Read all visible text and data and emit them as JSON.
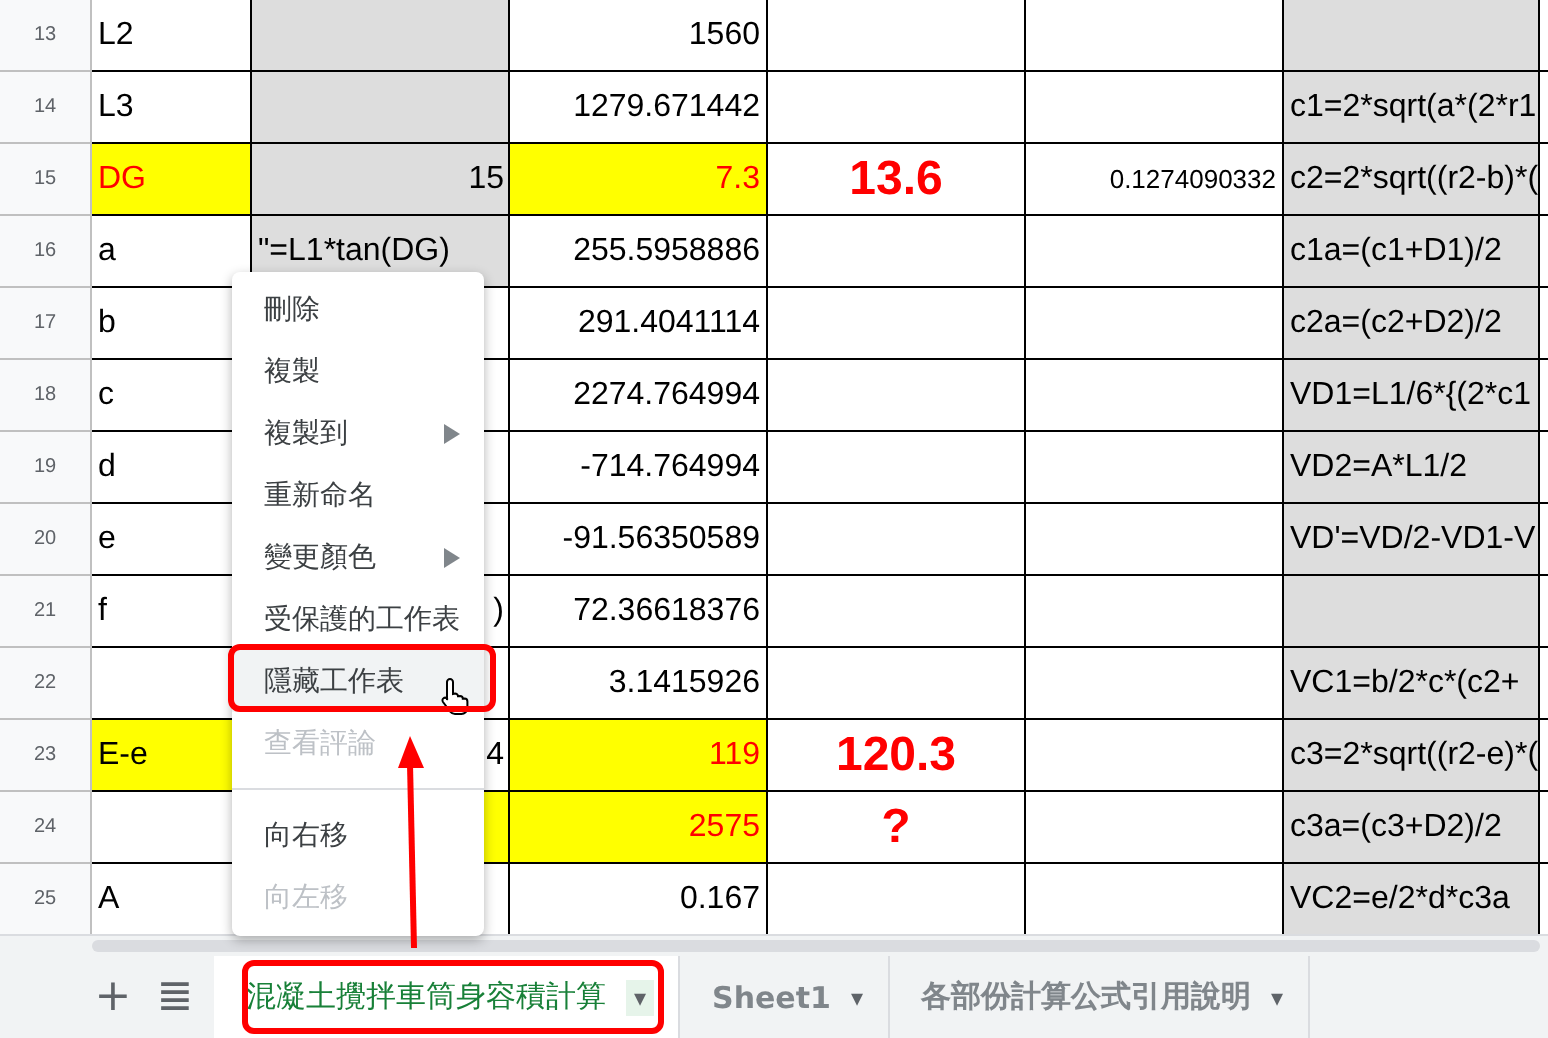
{
  "rows": [
    {
      "number": "13",
      "cells": [
        {
          "text": "L2",
          "kind": "label",
          "shaded": false,
          "highlighted": false
        },
        {
          "kind": "label",
          "shaded": true,
          "highlighted": false
        },
        {
          "text": "1560",
          "kind": "number",
          "shaded": false,
          "highlighted": false
        },
        {
          "kind": "label",
          "shaded": false,
          "highlighted": false
        },
        {
          "kind": "label",
          "shaded": false,
          "highlighted": false
        },
        {
          "kind": "label",
          "shaded": true,
          "highlighted": false
        }
      ]
    },
    {
      "number": "14",
      "cells": [
        {
          "text": "L3",
          "kind": "label",
          "shaded": false,
          "highlighted": false
        },
        {
          "kind": "label",
          "shaded": true,
          "highlighted": false
        },
        {
          "text": "1279.671442",
          "kind": "number",
          "shaded": false,
          "highlighted": false
        },
        {
          "kind": "label",
          "shaded": false,
          "highlighted": false
        },
        {
          "kind": "label",
          "shaded": false,
          "highlighted": false
        },
        {
          "text": "c1=2*sqrt(a*(2*r1",
          "kind": "label",
          "shaded": true,
          "highlighted": false
        }
      ]
    },
    {
      "number": "15",
      "cells": [
        {
          "text": "DG",
          "kind": "label",
          "shaded": false,
          "highlighted": true,
          "color": "#ff0000"
        },
        {
          "text": "15",
          "kind": "number",
          "shaded": true,
          "highlighted": false
        },
        {
          "text": "7.3",
          "kind": "number",
          "shaded": false,
          "highlighted": true,
          "color": "#ff0000"
        },
        {
          "text": "13.6",
          "kind": "big",
          "shaded": false,
          "highlighted": false,
          "color": "#ff0000"
        },
        {
          "text": "0.1274090332",
          "kind": "small",
          "shaded": false,
          "highlighted": false
        },
        {
          "text": "c2=2*sqrt((r2-b)*(",
          "kind": "label",
          "shaded": true,
          "highlighted": false
        }
      ]
    },
    {
      "number": "16",
      "cells": [
        {
          "text": "a",
          "kind": "label",
          "shaded": false,
          "highlighted": false
        },
        {
          "text": "\"=L1*tan(DG)",
          "kind": "label",
          "shaded": true,
          "highlighted": false
        },
        {
          "text": "255.5958886",
          "kind": "number",
          "shaded": false,
          "highlighted": false
        },
        {
          "kind": "label",
          "shaded": false,
          "highlighted": false
        },
        {
          "kind": "label",
          "shaded": false,
          "highlighted": false
        },
        {
          "text": "c1a=(c1+D1)/2",
          "kind": "label",
          "shaded": true,
          "highlighted": false
        }
      ]
    },
    {
      "number": "17",
      "cells": [
        {
          "text": "b",
          "kind": "label",
          "shaded": false,
          "highlighted": false
        },
        {
          "kind": "label",
          "shaded": false,
          "highlighted": false
        },
        {
          "text": "291.4041114",
          "kind": "number",
          "shaded": false,
          "highlighted": false
        },
        {
          "kind": "label",
          "shaded": false,
          "highlighted": false
        },
        {
          "kind": "label",
          "shaded": false,
          "highlighted": false
        },
        {
          "text": "c2a=(c2+D2)/2",
          "kind": "label",
          "shaded": true,
          "highlighted": false
        }
      ]
    },
    {
      "number": "18",
      "cells": [
        {
          "text": "c",
          "kind": "label",
          "shaded": false,
          "highlighted": false
        },
        {
          "kind": "label",
          "shaded": false,
          "highlighted": false
        },
        {
          "text": "2274.764994",
          "kind": "number",
          "shaded": false,
          "highlighted": false
        },
        {
          "kind": "label",
          "shaded": false,
          "highlighted": false
        },
        {
          "kind": "label",
          "shaded": false,
          "highlighted": false
        },
        {
          "text": "VD1=L1/6*{(2*c1",
          "kind": "label",
          "shaded": true,
          "highlighted": false
        }
      ]
    },
    {
      "number": "19",
      "cells": [
        {
          "text": "d",
          "kind": "label",
          "shaded": false,
          "highlighted": false
        },
        {
          "kind": "label",
          "shaded": false,
          "highlighted": false
        },
        {
          "text": "-714.764994",
          "kind": "number",
          "shaded": false,
          "highlighted": false
        },
        {
          "kind": "label",
          "shaded": false,
          "highlighted": false
        },
        {
          "kind": "label",
          "shaded": false,
          "highlighted": false
        },
        {
          "text": "VD2=A*L1/2",
          "kind": "label",
          "shaded": true,
          "highlighted": false
        }
      ]
    },
    {
      "number": "20",
      "cells": [
        {
          "text": "e",
          "kind": "label",
          "shaded": false,
          "highlighted": false
        },
        {
          "kind": "label",
          "shaded": false,
          "highlighted": false
        },
        {
          "text": "-91.56350589",
          "kind": "number",
          "shaded": false,
          "highlighted": false
        },
        {
          "kind": "label",
          "shaded": false,
          "highlighted": false
        },
        {
          "kind": "label",
          "shaded": false,
          "highlighted": false
        },
        {
          "text": "VD'=VD/2-VD1-V",
          "kind": "label",
          "shaded": true,
          "highlighted": false
        }
      ]
    },
    {
      "number": "21",
      "cells": [
        {
          "text": "f",
          "kind": "label",
          "shaded": false,
          "highlighted": false
        },
        {
          "text": ")",
          "kind": "number",
          "shaded": false,
          "highlighted": false
        },
        {
          "text": "72.36618376",
          "kind": "number",
          "shaded": false,
          "highlighted": false
        },
        {
          "kind": "label",
          "shaded": false,
          "highlighted": false
        },
        {
          "kind": "label",
          "shaded": false,
          "highlighted": false
        },
        {
          "kind": "label",
          "shaded": true,
          "highlighted": false
        }
      ]
    },
    {
      "number": "22",
      "cells": [
        {
          "kind": "label",
          "shaded": false,
          "highlighted": false
        },
        {
          "kind": "label",
          "shaded": false,
          "highlighted": false
        },
        {
          "text": "3.1415926",
          "kind": "number",
          "shaded": false,
          "highlighted": false
        },
        {
          "kind": "label",
          "shaded": false,
          "highlighted": false
        },
        {
          "kind": "label",
          "shaded": false,
          "highlighted": false
        },
        {
          "text": "VC1=b/2*c*(c2+",
          "kind": "label",
          "shaded": true,
          "highlighted": false
        }
      ]
    },
    {
      "number": "23",
      "cells": [
        {
          "text": "E-e",
          "kind": "label",
          "shaded": false,
          "highlighted": true
        },
        {
          "text": "4",
          "kind": "number",
          "shaded": false,
          "highlighted": false
        },
        {
          "text": "119",
          "kind": "number",
          "shaded": false,
          "highlighted": true,
          "color": "#ff0000"
        },
        {
          "text": "120.3",
          "kind": "big",
          "shaded": false,
          "highlighted": false,
          "color": "#ff0000"
        },
        {
          "kind": "label",
          "shaded": false,
          "highlighted": false
        },
        {
          "text": "c3=2*sqrt((r2-e)*(",
          "kind": "label",
          "shaded": true,
          "highlighted": false
        }
      ]
    },
    {
      "number": "24",
      "cells": [
        {
          "kind": "label",
          "shaded": false,
          "highlighted": false
        },
        {
          "kind": "label",
          "shaded": false,
          "highlighted": true
        },
        {
          "text": "2575",
          "kind": "number",
          "shaded": false,
          "highlighted": true,
          "color": "#ff0000"
        },
        {
          "text": "?",
          "kind": "big",
          "shaded": false,
          "highlighted": false,
          "color": "#ff0000"
        },
        {
          "kind": "label",
          "shaded": false,
          "highlighted": false
        },
        {
          "text": "c3a=(c3+D2)/2",
          "kind": "label",
          "shaded": true,
          "highlighted": false
        }
      ]
    },
    {
      "number": "25",
      "cells": [
        {
          "text": "A",
          "kind": "label",
          "shaded": false,
          "highlighted": false
        },
        {
          "kind": "label",
          "shaded": false,
          "highlighted": false
        },
        {
          "text": "0.167",
          "kind": "number",
          "shaded": false,
          "highlighted": false
        },
        {
          "kind": "label",
          "shaded": false,
          "highlighted": false
        },
        {
          "kind": "label",
          "shaded": false,
          "highlighted": false
        },
        {
          "text": "VC2=e/2*d*c3a",
          "kind": "label",
          "shaded": true,
          "highlighted": false
        }
      ]
    }
  ],
  "context_menu": [
    {
      "kind": "item",
      "label": "刪除",
      "submenu": false,
      "disabled": false,
      "hovered": false
    },
    {
      "kind": "item",
      "label": "複製",
      "submenu": false,
      "disabled": false,
      "hovered": false
    },
    {
      "kind": "item",
      "label": "複製到",
      "submenu": true,
      "disabled": false,
      "hovered": false
    },
    {
      "kind": "item",
      "label": "重新命名",
      "submenu": false,
      "disabled": false,
      "hovered": false
    },
    {
      "kind": "item",
      "label": "變更顏色",
      "submenu": true,
      "disabled": false,
      "hovered": false
    },
    {
      "kind": "item",
      "label": "受保護的工作表",
      "submenu": false,
      "disabled": false,
      "hovered": false
    },
    {
      "kind": "item",
      "label": "隱藏工作表",
      "submenu": false,
      "disabled": false,
      "hovered": true
    },
    {
      "kind": "item",
      "label": "查看評論",
      "submenu": false,
      "disabled": true,
      "hovered": false
    },
    {
      "kind": "divider"
    },
    {
      "kind": "item",
      "label": "向右移",
      "submenu": false,
      "disabled": false,
      "hovered": false
    },
    {
      "kind": "item",
      "label": "向左移",
      "submenu": false,
      "disabled": true,
      "hovered": false
    }
  ],
  "sheet_bar": {
    "add": "+",
    "list": "≣"
  },
  "tabs": [
    {
      "label": "混凝土攪拌車筒身容積計算",
      "caret": "▾",
      "selected": true
    },
    {
      "label": "Sheet1",
      "caret": "▾",
      "selected": false
    },
    {
      "label": "各部份計算公式引用說明",
      "caret": "▾",
      "selected": false
    }
  ]
}
